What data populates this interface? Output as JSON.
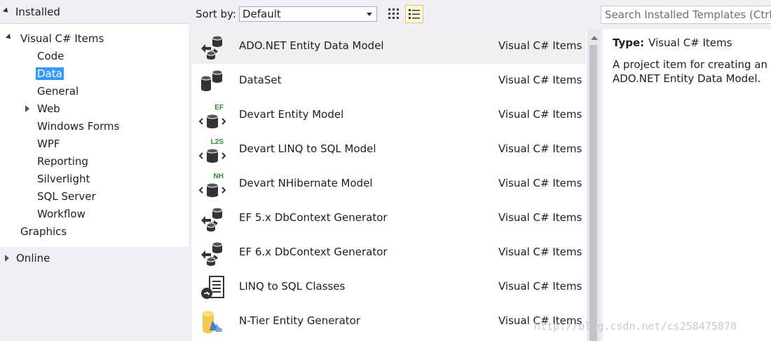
{
  "sidebar": {
    "installed_label": "Installed",
    "tree": [
      {
        "label": "Visual C# Items",
        "level": 0,
        "expanded": true
      },
      {
        "label": "Code",
        "level": 1
      },
      {
        "label": "Data",
        "level": 1,
        "selected": true
      },
      {
        "label": "General",
        "level": 1
      },
      {
        "label": "Web",
        "level": 1,
        "collapsed": true
      },
      {
        "label": "Windows Forms",
        "level": 1
      },
      {
        "label": "WPF",
        "level": 1
      },
      {
        "label": "Reporting",
        "level": 1
      },
      {
        "label": "Silverlight",
        "level": 1
      },
      {
        "label": "SQL Server",
        "level": 1
      },
      {
        "label": "Workflow",
        "level": 1
      },
      {
        "label": "Graphics",
        "level": 0
      }
    ],
    "online_label": "Online"
  },
  "toolbar": {
    "sort_label": "Sort by:",
    "sort_value": "Default",
    "search_placeholder": "Search Installed Templates (Ctrl+E)"
  },
  "templates": [
    {
      "name": "ADO.NET Entity Data Model",
      "category": "Visual C# Items",
      "icon": "entity-model-icon",
      "selected": true
    },
    {
      "name": "DataSet",
      "category": "Visual C# Items",
      "icon": "dataset-icon"
    },
    {
      "name": "Devart Entity Model",
      "category": "Visual C# Items",
      "icon": "devart-ef-icon",
      "badge": "EF"
    },
    {
      "name": "Devart LINQ to SQL Model",
      "category": "Visual C# Items",
      "icon": "devart-l2s-icon",
      "badge": "L2S"
    },
    {
      "name": "Devart NHibernate Model",
      "category": "Visual C# Items",
      "icon": "devart-nh-icon",
      "badge": "NH"
    },
    {
      "name": "EF 5.x DbContext Generator",
      "category": "Visual C# Items",
      "icon": "entity-model-icon"
    },
    {
      "name": "EF 6.x DbContext Generator",
      "category": "Visual C# Items",
      "icon": "entity-model-icon"
    },
    {
      "name": "LINQ to SQL Classes",
      "category": "Visual C# Items",
      "icon": "linq-sql-icon"
    },
    {
      "name": "N-Tier Entity Generator",
      "category": "Visual C# Items",
      "icon": "ntier-icon"
    }
  ],
  "details": {
    "type_label": "Type:",
    "type_value": "Visual C# Items",
    "description": "A project item for creating an ADO.NET Entity Data Model."
  },
  "watermark": "http://blog.csdn.net/cs258475870",
  "colors": {
    "selection": "#3399ff",
    "badge_green": "#2e8b2e",
    "panel_bg": "#eef0f6"
  }
}
